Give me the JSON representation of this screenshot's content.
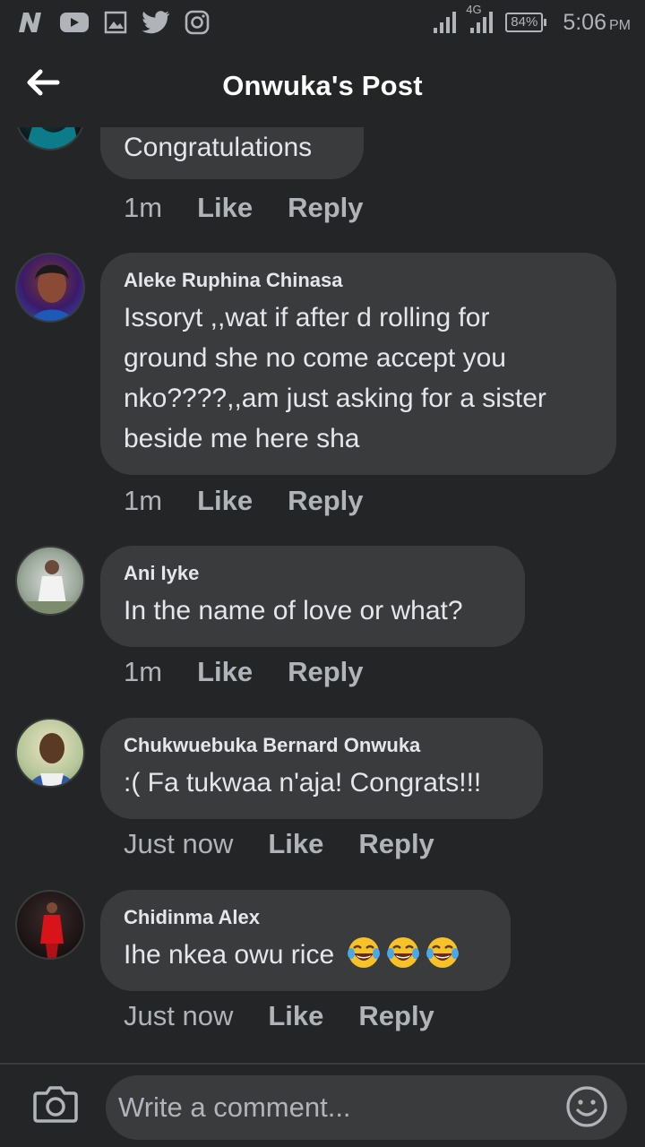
{
  "status_bar": {
    "network_type": "4G",
    "battery": "84%",
    "time": "5:06",
    "ampm": "PM",
    "icons": [
      "n-icon",
      "youtube-icon",
      "gallery-icon",
      "twitter-icon",
      "instagram-icon",
      "signal-icon",
      "signal-4g-icon",
      "battery-icon"
    ]
  },
  "header": {
    "title": "Onwuka's Post",
    "back_icon": "arrow-left-icon"
  },
  "comments": [
    {
      "author": "",
      "text": "Congratulations",
      "time": "1m",
      "like": "Like",
      "reply": "Reply"
    },
    {
      "author": "Aleke Ruphina Chinasa",
      "text_lines": [
        "Issoryt ,,wat if after d rolling for",
        "ground she no come accept you",
        "nko????,,am just asking for a sister",
        "beside me here sha"
      ],
      "time": "1m",
      "like": "Like",
      "reply": "Reply"
    },
    {
      "author": "Ani Iyke",
      "text": "In the name of love or what?",
      "time": "1m",
      "like": "Like",
      "reply": "Reply"
    },
    {
      "author": "Chukwuebuka Bernard Onwuka",
      "text": ":( Fa tukwaa n'aja! Congrats!!!",
      "time": "Just now",
      "like": "Like",
      "reply": "Reply"
    },
    {
      "author": "Chidinma Alex",
      "text": "Ihe nkea owu rice",
      "emojis": [
        "tears-of-joy-emoji",
        "tears-of-joy-emoji",
        "tears-of-joy-emoji"
      ],
      "time": "Just now",
      "like": "Like",
      "reply": "Reply"
    }
  ],
  "composer": {
    "placeholder": "Write a comment...",
    "camera_icon": "camera-icon",
    "emoji_icon": "smiley-icon"
  },
  "colors": {
    "background": "#242526",
    "bubble": "#3a3b3c",
    "text": "#e4e6eb",
    "secondary_text": "#b0b3b8"
  }
}
